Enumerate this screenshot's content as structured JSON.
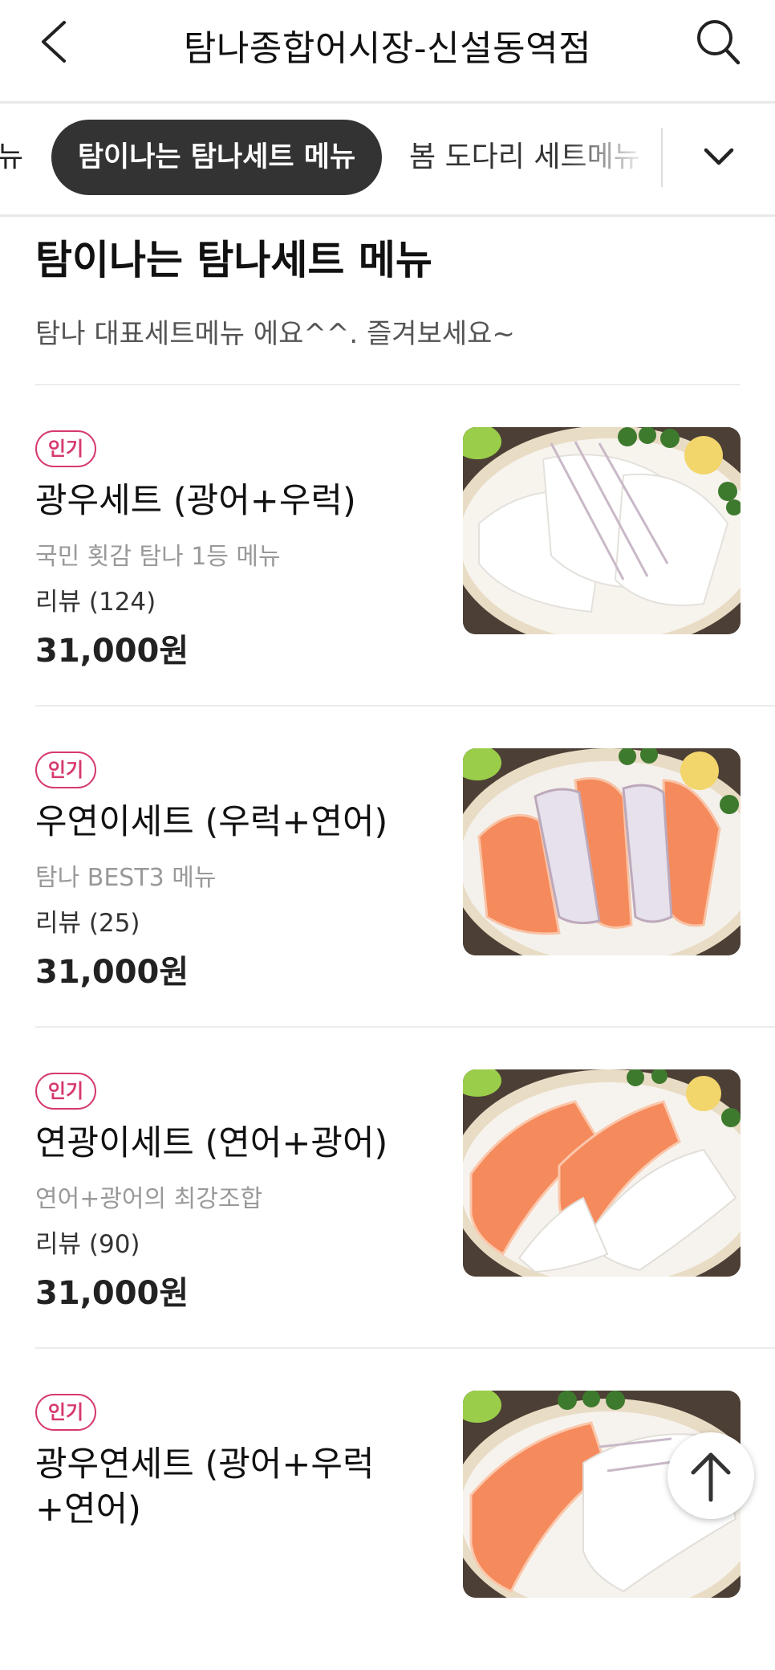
{
  "header": {
    "title": "탐나종합어시장-신설동역점",
    "back_icon": "chevron-left-icon",
    "search_icon": "search-icon"
  },
  "tabs": {
    "prev_partial": "뉴",
    "active": "탐이나는 탐나세트 메뉴",
    "next": "봄 도다리 세트메뉴",
    "expand_icon": "chevron-down-icon"
  },
  "section": {
    "title": "탐이나는 탐나세트 메뉴",
    "description": "탐나 대표세트메뉴 에요^^. 즐겨보세요~"
  },
  "items": [
    {
      "badge": "인기",
      "name": "광우세트 (광어+우럭)",
      "description": "국민 횟감 탐나 1등 메뉴",
      "review": "리뷰 (124)",
      "price": "31,000원"
    },
    {
      "badge": "인기",
      "name": "우연이세트 (우럭+연어)",
      "description": "탐나 BEST3 메뉴",
      "review": "리뷰 (25)",
      "price": "31,000원"
    },
    {
      "badge": "인기",
      "name": "연광이세트 (연어+광어)",
      "description": "연어+광어의 최강조합",
      "review": "리뷰 (90)",
      "price": "31,000원"
    },
    {
      "badge": "인기",
      "name": "광우연세트 (광어+우럭+연어)",
      "description": "",
      "review": "",
      "price": ""
    }
  ],
  "colors": {
    "accent": "#d63a6d",
    "active_tab_bg": "#333333",
    "salmon": "#f58a5c"
  },
  "scroll_top_icon": "arrow-up-icon"
}
